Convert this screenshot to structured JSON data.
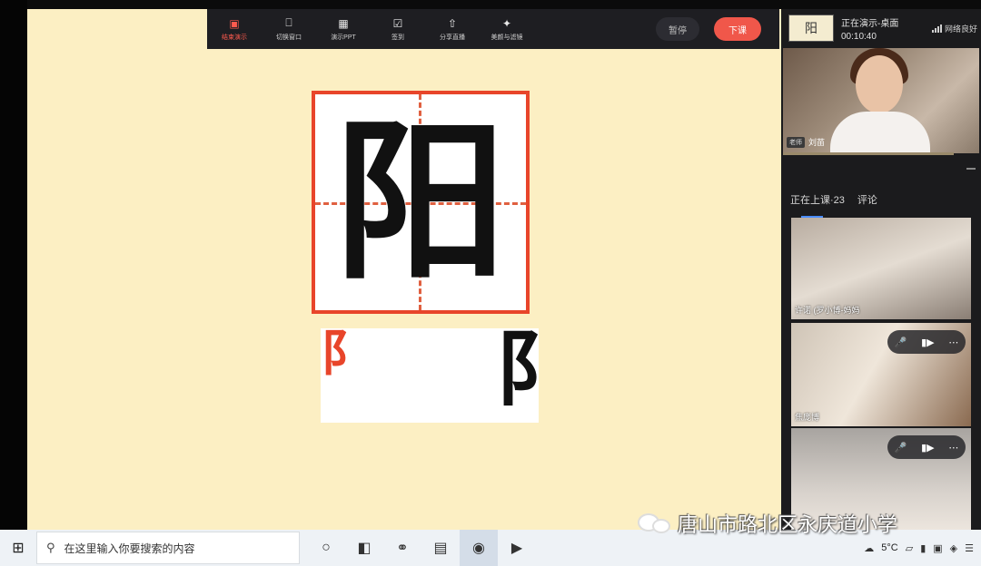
{
  "toolbar": {
    "items": [
      {
        "label": "结束演示",
        "icon": "screen-share-icon"
      },
      {
        "label": "切换窗口",
        "icon": "switch-window-icon"
      },
      {
        "label": "演示PPT",
        "icon": "ppt-icon"
      },
      {
        "label": "签到",
        "icon": "checkin-icon"
      },
      {
        "label": "分享直播",
        "icon": "share-icon"
      },
      {
        "label": "美颜与滤镜",
        "icon": "beauty-filter-icon"
      }
    ],
    "pause_label": "暂停",
    "end_label": "下课",
    "accent": "#f0574a"
  },
  "slide": {
    "character": "阳",
    "radical_left": "阝",
    "radical_right": "阝",
    "border_color": "#e8452a"
  },
  "presenting": {
    "thumb_char": "阳",
    "status": "正在演示-桌面",
    "timer": "00:10:40",
    "network": "网络良好"
  },
  "teacher": {
    "badge": "老师",
    "name": "刘苗"
  },
  "tabs": [
    {
      "label": "正在上课·23"
    },
    {
      "label": "评论"
    }
  ],
  "students": [
    {
      "name": "许诺 (罗小博-妈妈"
    },
    {
      "name": "焦庞博"
    },
    {
      "name": ""
    }
  ],
  "taskbar": {
    "search_placeholder": "在这里输入你要搜索的内容",
    "temperature": "5°C"
  },
  "watermark": {
    "text": "唐山市路北区永庆道小学"
  }
}
